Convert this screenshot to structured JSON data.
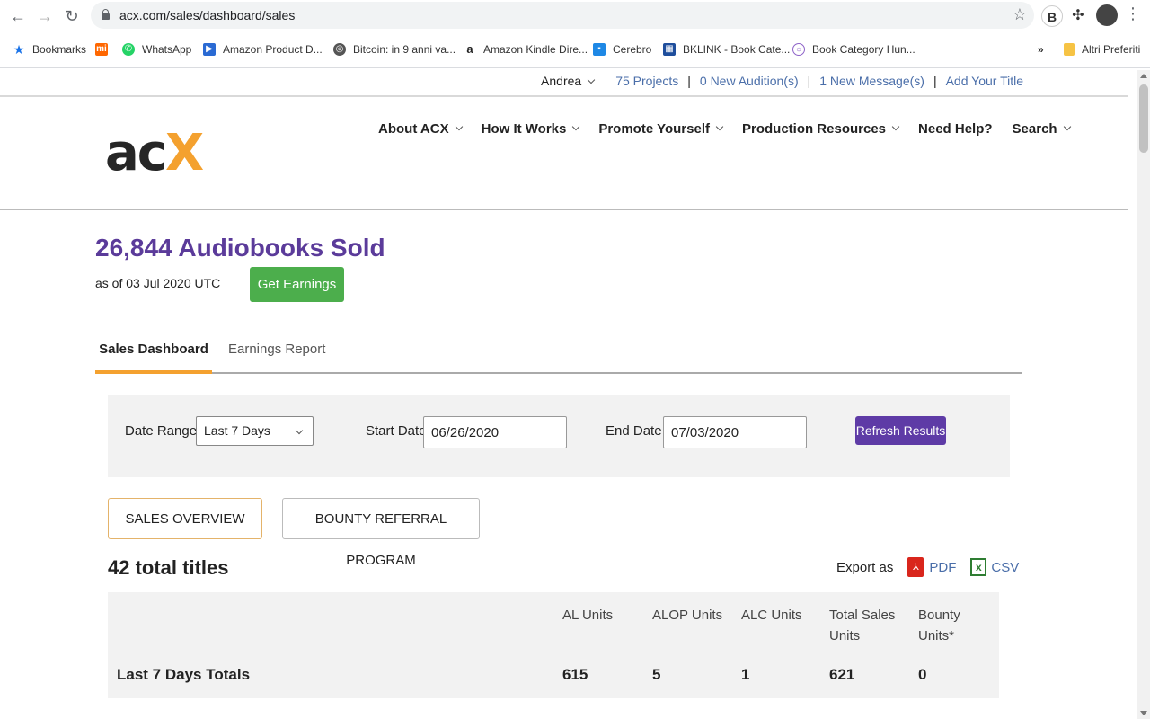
{
  "browser": {
    "url": "acx.com/sales/dashboard/sales",
    "bookmarks": [
      {
        "label": "Bookmarks",
        "icon": "star-icon",
        "color": "#1a73e8"
      },
      {
        "label": "",
        "icon": "mi-icon",
        "color": "#ff6700"
      },
      {
        "label": "WhatsApp",
        "icon": "whatsapp-icon",
        "color": "#25d366"
      },
      {
        "label": "Amazon Product D...",
        "icon": "amazon-product-icon",
        "color": "#2a6ad3"
      },
      {
        "label": "Bitcoin: in 9 anni va...",
        "icon": "globe-icon",
        "color": "#555555"
      },
      {
        "label": "Amazon Kindle Dire...",
        "icon": "amazon-icon",
        "color": "#222222"
      },
      {
        "label": "Cerebro",
        "icon": "cerebro-icon",
        "color": "#1e88e5"
      },
      {
        "label": "BKLINK - Book Cate...",
        "icon": "bklink-icon",
        "color": "#1f4e9c"
      },
      {
        "label": "Book Category Hun...",
        "icon": "hunter-icon",
        "color": "#8e63c8"
      },
      {
        "label": "Altri Preferiti",
        "icon": "folder-icon",
        "color": "#f6c344"
      }
    ],
    "more_bookmarks": "»"
  },
  "topbar": {
    "user": "Andrea",
    "projects": "75 Projects",
    "auditions": "0 New Audition(s)",
    "messages": "1 New Message(s)",
    "add_title": "Add Your Title",
    "separator": "|"
  },
  "nav": {
    "logo_a": "ac",
    "logo_x": "X",
    "items": [
      "About ACX",
      "How It Works",
      "Promote Yourself",
      "Production Resources",
      "Need Help?",
      "Search"
    ]
  },
  "summary": {
    "sold": "26,844 Audiobooks Sold",
    "as_of": "as of 03 Jul 2020 UTC",
    "get_earnings": "Get Earnings"
  },
  "tabs": {
    "sales_dashboard": "Sales Dashboard",
    "earnings_report": "Earnings Report"
  },
  "filter": {
    "date_range_label": "Date Range",
    "date_range_value": "Last 7 Days",
    "start_label": "Start Date",
    "start_value": "06/26/2020",
    "end_label": "End Date",
    "end_value": "07/03/2020",
    "refresh": "Refresh Results"
  },
  "segments": {
    "overview": "SALES OVERVIEW",
    "bounty": "BOUNTY REFERRAL PROGRAM"
  },
  "titles": {
    "total": "42 total titles",
    "export_as": "Export as",
    "pdf": "PDF",
    "csv": "CSV"
  },
  "table": {
    "headers": [
      "AL Units",
      "ALOP Units",
      "ALC Units",
      "Total Sales\nUnits",
      "Bounty\nUnits*"
    ],
    "row_label": "Last 7 Days Totals",
    "values": [
      "615",
      "5",
      "1",
      "621",
      "0"
    ]
  }
}
